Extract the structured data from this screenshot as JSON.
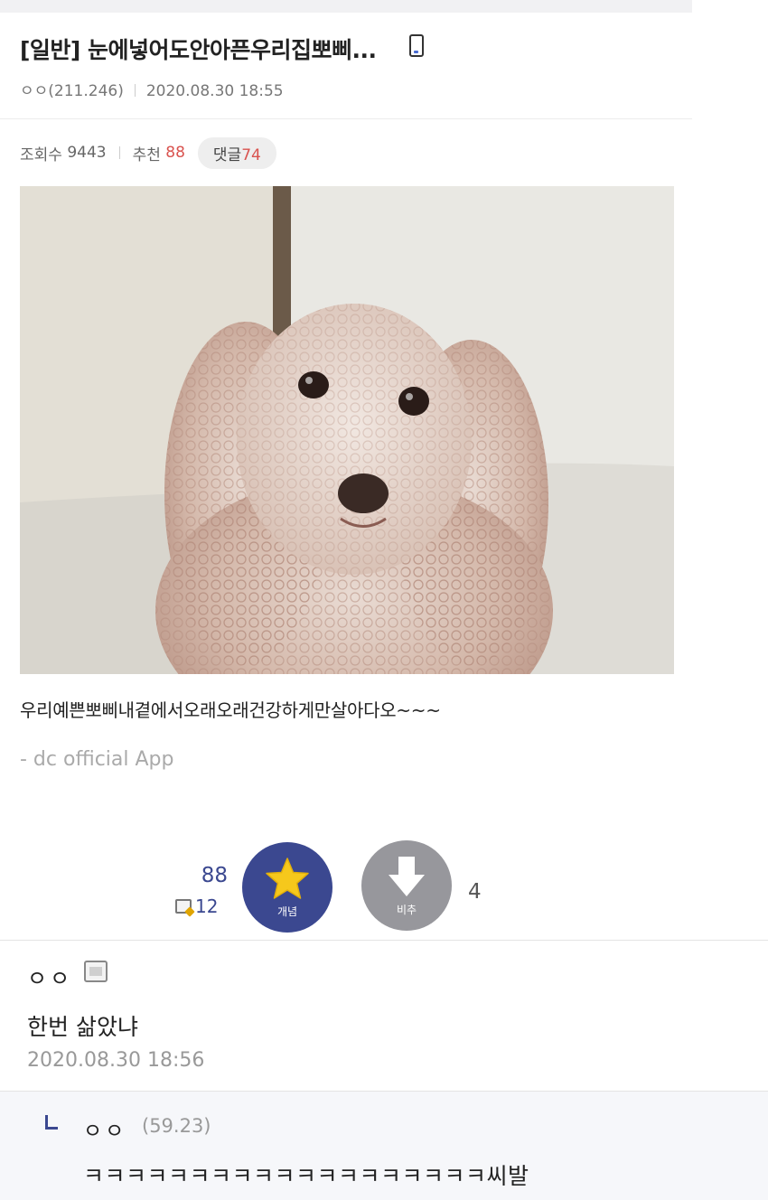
{
  "post": {
    "title": "[일반] 눈에넣어도안아픈우리집뽀삐...",
    "author": "ㅇㅇ(211.246)",
    "datetime": "2020.08.30 18:55",
    "views_label": "조회수",
    "views": "9443",
    "recommend_label": "추천",
    "recommend": "88",
    "comments_label": "댓글",
    "comments": "74",
    "caption": "우리예쁜뽀삐내곁에서오래오래건강하게만살아다오~~~",
    "app_signature": "- dc official App"
  },
  "vote": {
    "up_count": "88",
    "fixed_count": "12",
    "up_label": "개념",
    "down_label": "비추",
    "down_count": "4"
  },
  "comment": {
    "nick": "ㅇㅇ",
    "body": "한번 삶았냐",
    "datetime": "2020.08.30 18:56"
  },
  "reply": {
    "nick": "ㅇㅇ",
    "ip": "(59.23)",
    "body": "ㅋㅋㅋㅋㅋㅋㅋㅋㅋㅋㅋㅋㅋㅋㅋㅋㅋㅋㅋ씨발"
  },
  "colors": {
    "accent": "#3b4890",
    "downvote": "#97979c",
    "recommend_red": "#d9534f"
  }
}
